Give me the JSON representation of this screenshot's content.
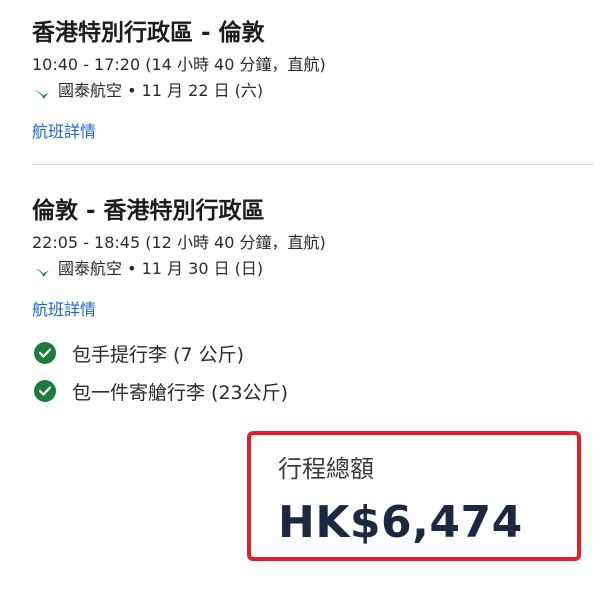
{
  "flights": [
    {
      "route": "香港特別行政區 - 倫敦",
      "times": "10:40 - 17:20 (14 小時 40 分鐘，直航)",
      "airline_info": "國泰航空 • 11 月 22 日 (六)",
      "details_link": "航班詳情",
      "airline_logo_icon": "cathay-pacific-logo-icon"
    },
    {
      "route": "倫敦 - 香港特別行政區",
      "times": "22:05 - 18:45 (12 小時 40 分鐘，直航)",
      "airline_info": "國泰航空 • 11 月 30 日 (日)",
      "details_link": "航班詳情",
      "airline_logo_icon": "cathay-pacific-logo-icon"
    }
  ],
  "baggage": [
    {
      "text": "包手提行李 (7 公斤)",
      "icon": "check-circle-icon"
    },
    {
      "text": "包一件寄艙行李 (23公斤)",
      "icon": "check-circle-icon"
    }
  ],
  "total": {
    "label": "行程總額",
    "amount": "HK$6,474"
  },
  "colors": {
    "link": "#1a66c9",
    "check": "#1e7b3e",
    "highlight_border": "#e3202a",
    "amount_text": "#1e2742",
    "airline_logo": "#006564"
  }
}
